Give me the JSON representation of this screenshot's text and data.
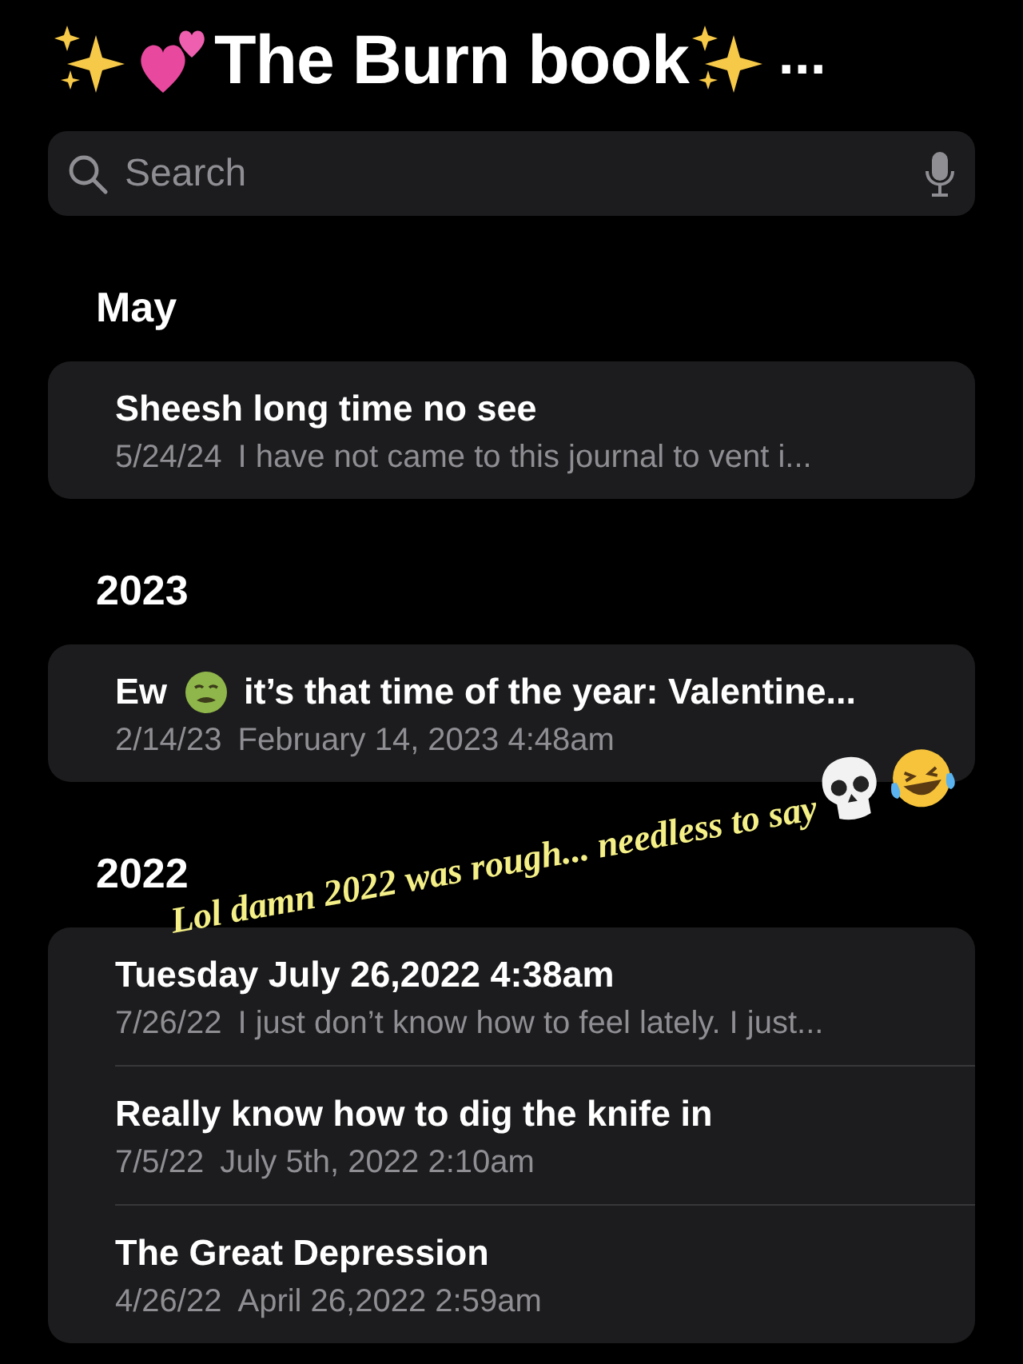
{
  "title": "The Burn book",
  "title_overflow": "...",
  "search": {
    "placeholder": "Search"
  },
  "sections": [
    {
      "heading": "May",
      "notes": [
        {
          "title": [
            {
              "kind": "text",
              "text": "Sheesh long time no see"
            }
          ],
          "date": "5/24/24",
          "preview": "I have not came to this journal to vent i..."
        }
      ]
    },
    {
      "heading": "2023",
      "notes": [
        {
          "title": [
            {
              "kind": "text",
              "text": "Ew"
            },
            {
              "kind": "sick-emoji"
            },
            {
              "kind": "text",
              "text": "it’s that time of the year: Valentine..."
            }
          ],
          "date": "2/14/23",
          "preview": "February 14, 2023 4:48am"
        }
      ]
    },
    {
      "heading": "2022",
      "notes": [
        {
          "title": [
            {
              "kind": "text",
              "text": "Tuesday July 26,2022 4:38am"
            }
          ],
          "date": "7/26/22",
          "preview": "I just don’t know how to feel lately. I just..."
        },
        {
          "title": [
            {
              "kind": "text",
              "text": "Really know how to dig the knife in"
            }
          ],
          "date": "7/5/22",
          "preview": "July 5th, 2022 2:10am"
        },
        {
          "title": [
            {
              "kind": "text",
              "text": "The Great Depression"
            }
          ],
          "date": "4/26/22",
          "preview": "April 26,2022 2:59am"
        }
      ]
    }
  ],
  "overlay": {
    "text": "Lol damn 2022 was rough... needless to say"
  }
}
